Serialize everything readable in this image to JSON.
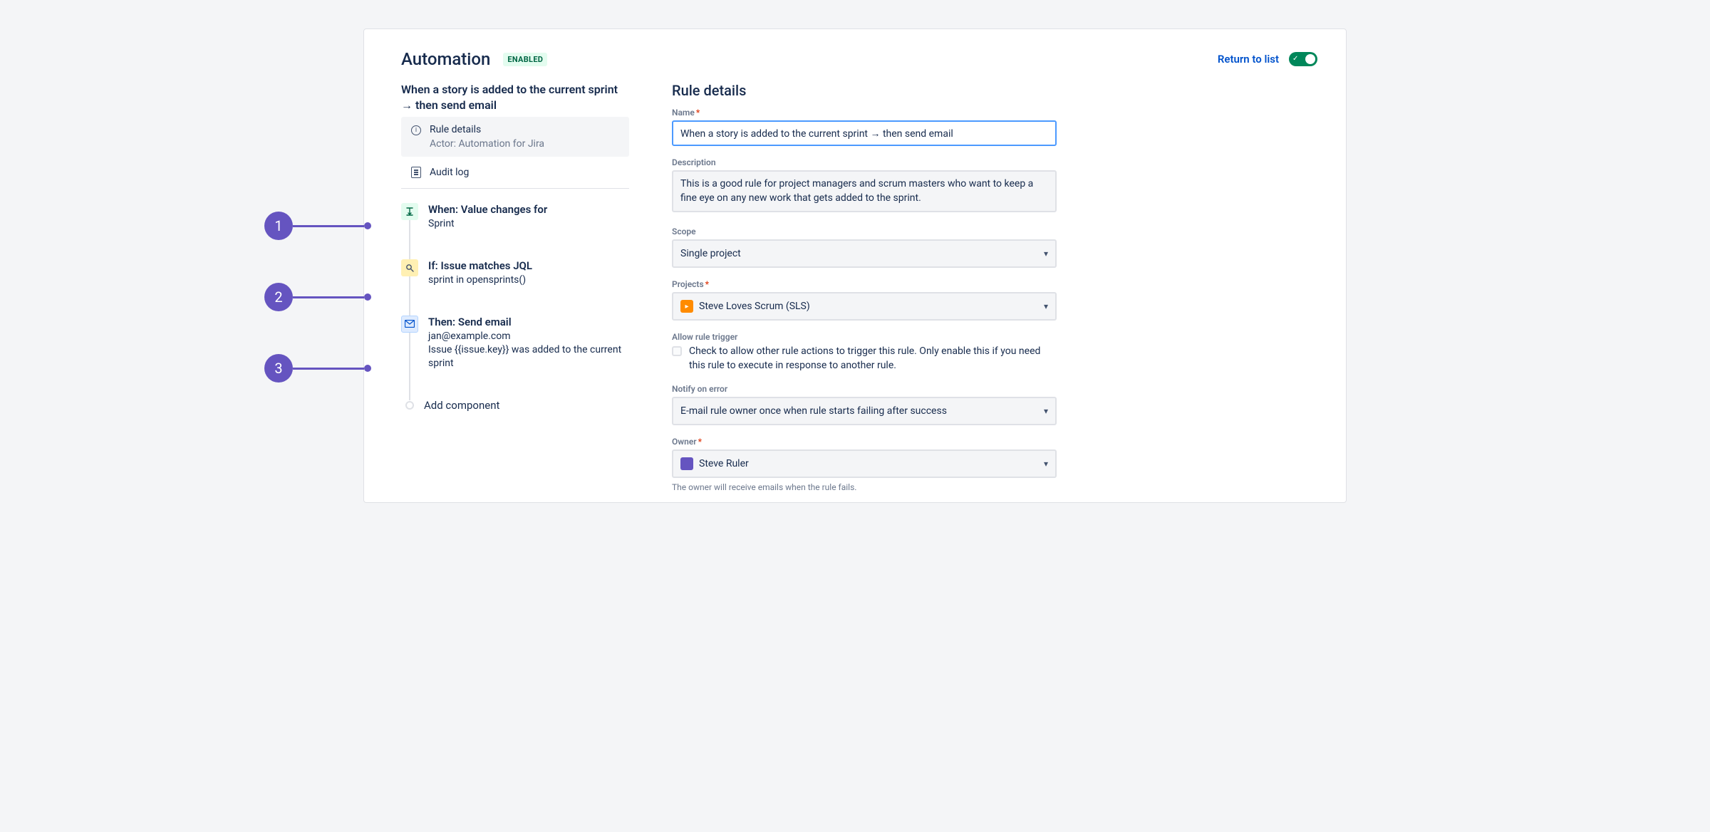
{
  "header": {
    "title": "Automation",
    "status": "ENABLED",
    "return_link": "Return to list"
  },
  "rule": {
    "name": "When a story is added to the current sprint → then send email",
    "details_label": "Rule details",
    "actor_label": "Actor: Automation for Jira",
    "audit_log": "Audit log"
  },
  "steps": [
    {
      "title": "When: Value changes for",
      "desc": "Sprint"
    },
    {
      "title": "If: Issue matches JQL",
      "desc": "sprint in opensprints()"
    },
    {
      "title": "Then: Send email",
      "desc": "jan@example.com\nIssue {{issue.key}} was added to the current sprint"
    }
  ],
  "add_component": "Add component",
  "details": {
    "heading": "Rule details",
    "name_label": "Name",
    "name_value": "When a story is added to the current sprint → then send email",
    "desc_label": "Description",
    "desc_value": "This is a good rule for project managers and scrum masters who want to keep a fine eye on any new work that gets added to the sprint.",
    "scope_label": "Scope",
    "scope_value": "Single project",
    "projects_label": "Projects",
    "projects_value": "Steve Loves Scrum (SLS)",
    "allow_trigger_label": "Allow rule trigger",
    "allow_trigger_desc": "Check to allow other rule actions to trigger this rule. Only enable this if you need this rule to execute in response to another rule.",
    "notify_label": "Notify on error",
    "notify_value": "E-mail rule owner once when rule starts failing after success",
    "owner_label": "Owner",
    "owner_value": "Steve Ruler",
    "owner_helper": "The owner will receive emails when the rule fails."
  },
  "callouts": [
    "1",
    "2",
    "3"
  ]
}
